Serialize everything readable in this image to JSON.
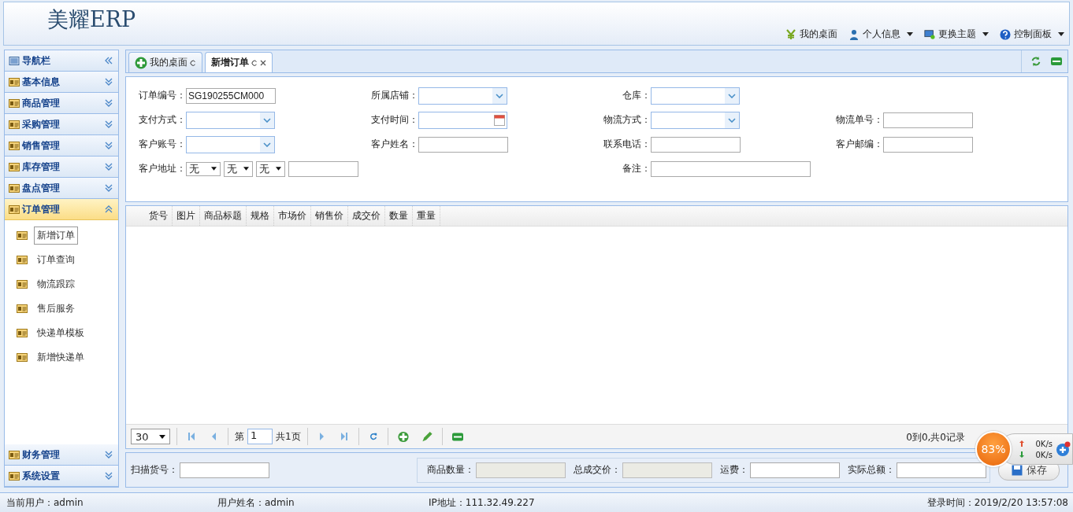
{
  "header": {
    "logo": "美耀ERP",
    "menu": [
      {
        "label": "我的桌面",
        "dropdown": false
      },
      {
        "label": "个人信息",
        "dropdown": true
      },
      {
        "label": "更换主题",
        "dropdown": true
      },
      {
        "label": "控制面板",
        "dropdown": true
      }
    ]
  },
  "sidebar": {
    "title": "导航栏",
    "groups": [
      {
        "label": "基本信息",
        "expanded": false
      },
      {
        "label": "商品管理",
        "expanded": false
      },
      {
        "label": "采购管理",
        "expanded": false
      },
      {
        "label": "销售管理",
        "expanded": false
      },
      {
        "label": "库存管理",
        "expanded": false
      },
      {
        "label": "盘点管理",
        "expanded": false
      },
      {
        "label": "订单管理",
        "expanded": true,
        "children": [
          {
            "label": "新增订单",
            "selected": true
          },
          {
            "label": "订单查询",
            "selected": false
          },
          {
            "label": "物流跟踪",
            "selected": false
          },
          {
            "label": "售后服务",
            "selected": false
          },
          {
            "label": "快递单模板",
            "selected": false
          },
          {
            "label": "新增快递单",
            "selected": false
          }
        ]
      }
    ],
    "bottom_groups": [
      {
        "label": "财务管理",
        "expanded": false
      },
      {
        "label": "系统设置",
        "expanded": false
      }
    ]
  },
  "tabs": [
    {
      "label": "我的桌面",
      "selected": false,
      "closable": false
    },
    {
      "label": "新增订单",
      "selected": true,
      "closable": true
    }
  ],
  "form": {
    "rows": [
      [
        {
          "label": "订单编号：",
          "kind": "text",
          "value": "SG190255CM000"
        },
        {
          "label": "所属店铺：",
          "kind": "select"
        },
        {
          "label": "仓库：",
          "kind": "select"
        }
      ],
      [
        {
          "label": "支付方式：",
          "kind": "select"
        },
        {
          "label": "支付时间：",
          "kind": "date"
        },
        {
          "label": "物流方式：",
          "kind": "select"
        },
        {
          "label": "物流单号：",
          "kind": "text"
        }
      ],
      [
        {
          "label": "客户账号：",
          "kind": "select"
        },
        {
          "label": "客户姓名：",
          "kind": "text"
        },
        {
          "label": "联系电话：",
          "kind": "text"
        },
        {
          "label": "客户邮编：",
          "kind": "text"
        }
      ],
      [
        {
          "label": "客户地址：",
          "kind": "address",
          "selects": [
            "无",
            "无",
            "无"
          ]
        },
        {
          "kind": "blank"
        },
        {
          "label": "备注：",
          "kind": "wide"
        }
      ]
    ]
  },
  "table": {
    "columns": [
      "货号",
      "图片",
      "商品标题",
      "规格",
      "市场价",
      "销售价",
      "成交价",
      "数量",
      "重量"
    ]
  },
  "pager": {
    "page_size": "30",
    "page_label": "第",
    "page": "1",
    "total_pages": "共1页",
    "info": "0到0,共0记录"
  },
  "totals": {
    "scan": {
      "label": "扫描货号："
    },
    "fields": [
      {
        "label": "商品数量：",
        "disabled": true
      },
      {
        "label": "总成交价：",
        "disabled": true
      },
      {
        "label": "运费：",
        "disabled": false
      },
      {
        "label": "实际总额：",
        "disabled": false
      }
    ],
    "save": "保存"
  },
  "status_bar": [
    "当前用户：admin",
    "用户姓名：admin",
    "IP地址：111.32.49.227",
    "登录时间：2019/2/20 13:57:08"
  ],
  "net_widget": {
    "percent": "83%",
    "up": "0K/s",
    "down": "0K/s"
  }
}
